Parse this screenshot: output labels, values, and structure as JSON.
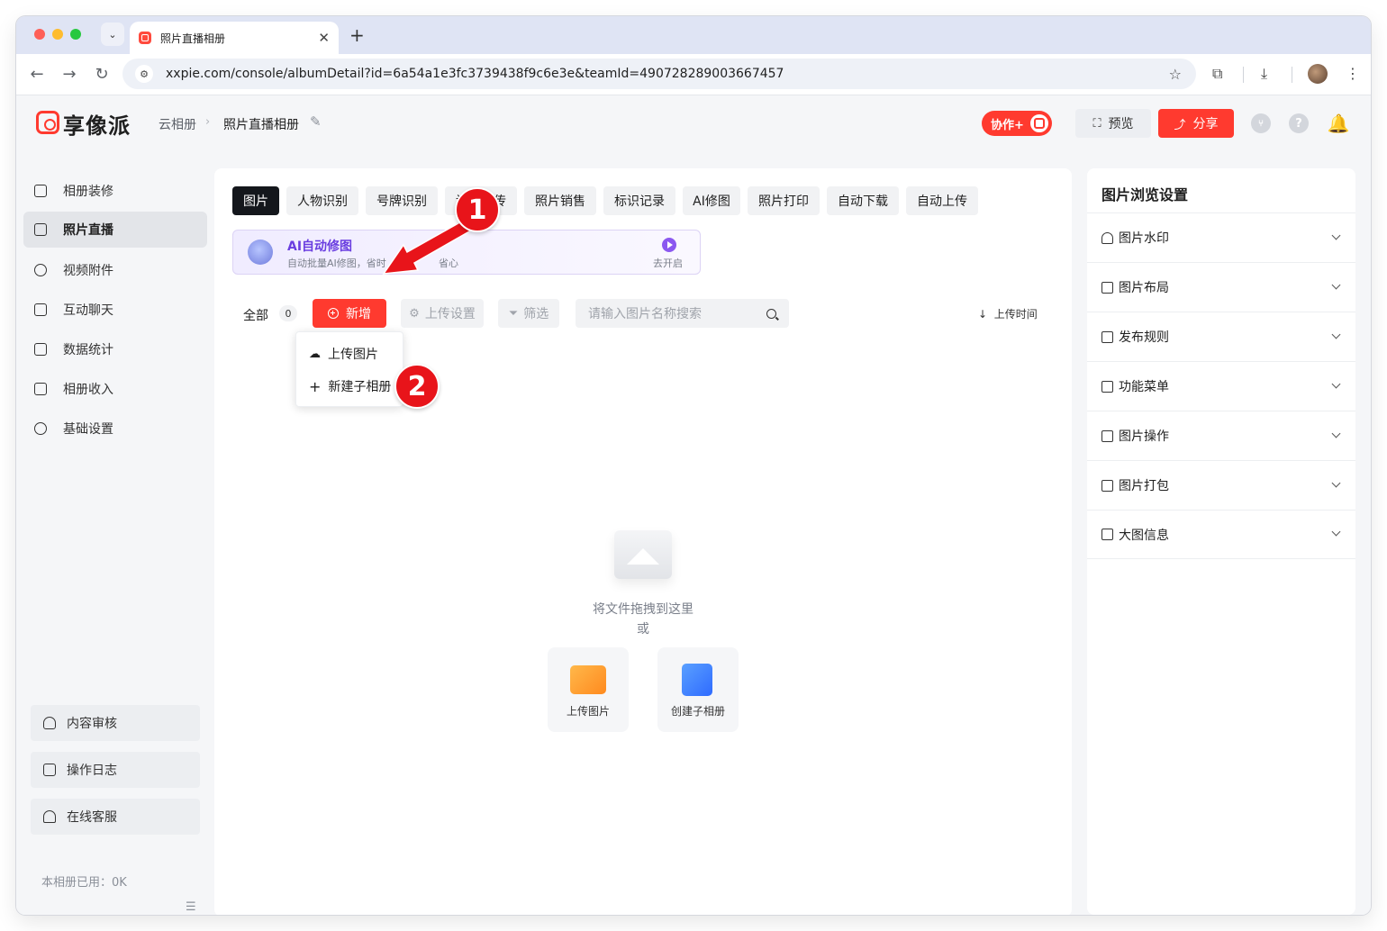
{
  "browser": {
    "tab_title": "照片直播相册",
    "tab_close": "✕",
    "new_tab": "+",
    "url": "xxpie.com/console/albumDetail?id=6a54a1e3fc3739438f9c6e3e&teamId=490728289003667457"
  },
  "header": {
    "logo_text": "享像派",
    "breadcrumb": [
      "云相册",
      "照片直播相册"
    ],
    "collab_label": "协作+",
    "preview_label": "预览",
    "share_label": "分享"
  },
  "sidebar": {
    "items": [
      {
        "label": "相册装修",
        "icon": "frame-icon"
      },
      {
        "label": "照片直播",
        "icon": "image-icon",
        "active": true
      },
      {
        "label": "视频附件",
        "icon": "paperclip-icon"
      },
      {
        "label": "互动聊天",
        "icon": "chat-icon"
      },
      {
        "label": "数据统计",
        "icon": "chart-icon"
      },
      {
        "label": "相册收入",
        "icon": "wallet-icon"
      },
      {
        "label": "基础设置",
        "icon": "gear-icon"
      }
    ],
    "bottom_items": [
      {
        "label": "内容审核",
        "icon": "user-check-icon"
      },
      {
        "label": "操作日志",
        "icon": "document-icon"
      },
      {
        "label": "在线客服",
        "icon": "headset-icon"
      }
    ],
    "usage_text": "本相册已用：0K"
  },
  "main": {
    "tabs": [
      "图片",
      "人物识别",
      "号牌识别",
      "访客上传",
      "照片销售",
      "标识记录",
      "AI修图",
      "照片打印",
      "自动下载",
      "自动上传"
    ],
    "ai_banner": {
      "title": "AI自动修图",
      "subtitle": "自动批量AI修图，省时",
      "subtitle_tail": "省心",
      "action": "去开启"
    },
    "toolbar": {
      "all_label": "全部",
      "count": "0",
      "add_label": "新增",
      "upload_settings_label": "上传设置",
      "filter_label": "筛选",
      "search_placeholder": "请输入图片名称搜索",
      "sort_label": "上传时间"
    },
    "dropdown": {
      "items": [
        "上传图片",
        "新建子相册"
      ]
    },
    "empty": {
      "drag_text": "将文件拖拽到这里",
      "or_text": "或",
      "upload_label": "上传图片",
      "create_album_label": "创建子相册"
    }
  },
  "right_panel": {
    "title": "图片浏览设置",
    "rows": [
      "图片水印",
      "图片布局",
      "发布规则",
      "功能菜单",
      "图片操作",
      "图片打包",
      "大图信息"
    ]
  },
  "annotations": [
    "1",
    "2"
  ],
  "colors": {
    "brand": "#ff3a2f",
    "annotation": "#e8141a",
    "ai_purple": "#6a3ee0"
  }
}
